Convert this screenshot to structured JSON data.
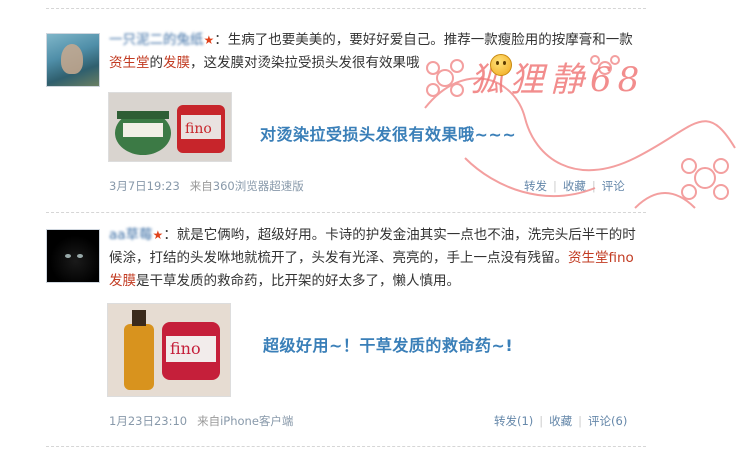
{
  "posts": [
    {
      "nickname": "一只泥二的兔纸",
      "star": "★",
      "text_parts": [
        "：生病了也要美美的，要好好爱自己。推荐一款瘦脸用的按摩膏和一款",
        "资生堂",
        "的",
        "发膜",
        "，这发膜对烫染拉受损头发很有效果哦"
      ],
      "image_caption": "对烫染拉受损头发很有效果哦~~~",
      "time": "3月7日19:23",
      "source_prefix": "来自",
      "source_link": "360浏览器超速版",
      "actions": [
        "转发",
        "收藏",
        "评论"
      ]
    },
    {
      "nickname": "aa草莓",
      "star": "★",
      "text_parts": [
        "：就是它俩哟，超级好用。卡诗的护发金油其实一点也不油，洗完头后半干的时候涂，打结的头发咻地就梳开了，头发有光泽、亮亮的，手上一点没有残留。",
        "资生堂",
        "fino发膜",
        "是干草发质的救命药，比开架的好太多了，懒人慎用。"
      ],
      "image_caption": "超级好用~！干草发质的救命药~!",
      "time": "1月23日23:10",
      "source_prefix": "来自",
      "source_link": "iPhone客户端",
      "actions": [
        "转发(1)",
        "收藏",
        "评论(6)"
      ]
    }
  ],
  "watermark": {
    "text": "狐狸静68",
    "color": "#f07a7a"
  },
  "colors": {
    "link": "#3b6ea5",
    "highlight": "#c23b22",
    "caption": "#3a7fb8",
    "meta": "#999999",
    "star": "#e0421b"
  }
}
